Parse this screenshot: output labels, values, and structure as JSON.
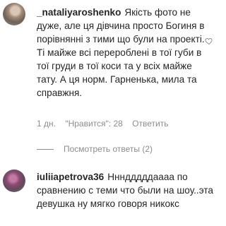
{
  "comments": [
    {
      "username": "_nataliyaroshenko",
      "text": "Якість фото не дуже, але ця дівчина просто Богиня в порівнянні з тими що були на проекті. Ті майже всі перероблені в тої губи в тої груди в тої коси та у всіх майже тату. А ця норм. Гарненька, мила та справжня.",
      "time": "1 дн.",
      "likes": "\"Нравится\": 28",
      "reply": "Ответить",
      "view_replies": "Посмотреть ответы (2)"
    },
    {
      "username": "iuliiapetrova36",
      "text": "Ннндддддаааа по сравнению с теми что были на шоу..эта девушка ну мягко говоря никокс"
    }
  ]
}
